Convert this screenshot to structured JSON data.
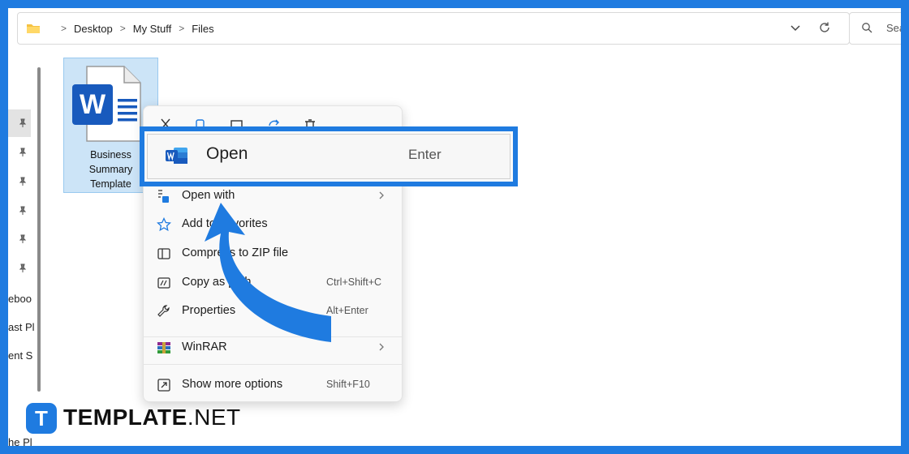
{
  "address_bar": {
    "breadcrumbs": [
      "Desktop",
      "My Stuff",
      "Files"
    ],
    "search_placeholder": "Sea"
  },
  "nav_pane": {
    "partial_items": [
      "eboo",
      "ast Pl",
      "ent S",
      "he Pl"
    ]
  },
  "file": {
    "name_lines": [
      "Business",
      "Summary",
      "Template"
    ],
    "icon": "word-document-icon",
    "icon_letter": "W"
  },
  "context_menu": {
    "quick_actions": [
      "cut-icon",
      "copy-icon",
      "rename-icon",
      "share-icon",
      "delete-icon"
    ],
    "open": {
      "label": "Open",
      "shortcut": "Enter"
    },
    "items": [
      {
        "label": "Open with",
        "shortcut": "",
        "submenu": true,
        "icon": "open-with-icon"
      },
      {
        "label": "Add to Favorites",
        "shortcut": "",
        "submenu": false,
        "icon": "star-icon"
      },
      {
        "label": "Compress to ZIP file",
        "shortcut": "",
        "submenu": false,
        "icon": "zip-icon"
      },
      {
        "label": "Copy as path",
        "shortcut": "Ctrl+Shift+C",
        "submenu": false,
        "icon": "copy-path-icon"
      },
      {
        "label": "Properties",
        "shortcut": "Alt+Enter",
        "submenu": false,
        "icon": "wrench-icon"
      },
      {
        "label": "WinRAR",
        "shortcut": "",
        "submenu": true,
        "icon": "winrar-icon"
      },
      {
        "label": "Show more options",
        "shortcut": "Shift+F10",
        "submenu": false,
        "icon": "more-options-icon"
      }
    ]
  },
  "brand": {
    "bold": "TEMPLATE",
    "light": ".NET",
    "badge_letter": "T"
  },
  "colors": {
    "accent": "#1f7be0",
    "selection": "#cce4f7",
    "word_blue": "#185abd"
  }
}
